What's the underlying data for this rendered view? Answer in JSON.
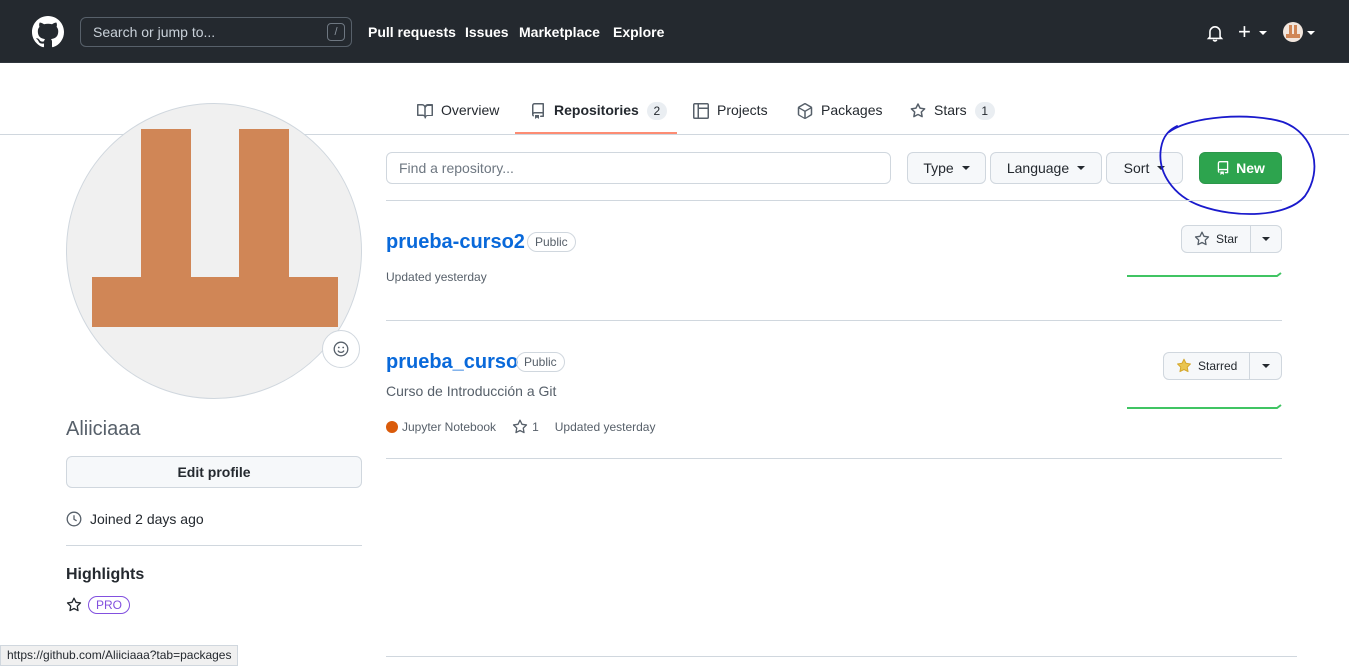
{
  "header": {
    "search_placeholder": "Search or jump to...",
    "search_shortcut": "/",
    "nav": [
      "Pull requests",
      "Issues",
      "Marketplace",
      "Explore"
    ],
    "plus": "+"
  },
  "tabs": [
    {
      "label": "Overview",
      "icon": "book-icon"
    },
    {
      "label": "Repositories",
      "icon": "repo-icon",
      "count": "2",
      "selected": true
    },
    {
      "label": "Projects",
      "icon": "table-icon"
    },
    {
      "label": "Packages",
      "icon": "package-icon"
    },
    {
      "label": "Stars",
      "icon": "star-icon",
      "count": "1"
    }
  ],
  "sidebar": {
    "username": "Aliiciaaa",
    "edit_profile": "Edit profile",
    "joined": "Joined 2 days ago",
    "highlights_title": "Highlights",
    "pro_badge": "PRO"
  },
  "filters": {
    "find_placeholder": "Find a repository...",
    "type": "Type",
    "language": "Language",
    "sort": "Sort",
    "new": "New"
  },
  "repos": [
    {
      "name": "prueba-curso2",
      "visibility": "Public",
      "description": "",
      "updated": "Updated yesterday",
      "star_label": "Star"
    },
    {
      "name": "prueba_curso",
      "visibility": "Public",
      "description": "Curso de Introducción a Git",
      "language": "Jupyter Notebook",
      "stars": "1",
      "updated": "Updated yesterday",
      "star_label": "Starred"
    }
  ],
  "status_bar_url": "https://github.com/Aliiciaaa?tab=packages",
  "colors": {
    "header_bg": "#24292f",
    "link": "#0969da",
    "primary_button": "#2da44e",
    "tab_underline": "#fd8c73",
    "avatar_identicon": "#d08656",
    "language_jupyter": "#da5b0b",
    "annotation_ink": "#1a1acc"
  }
}
